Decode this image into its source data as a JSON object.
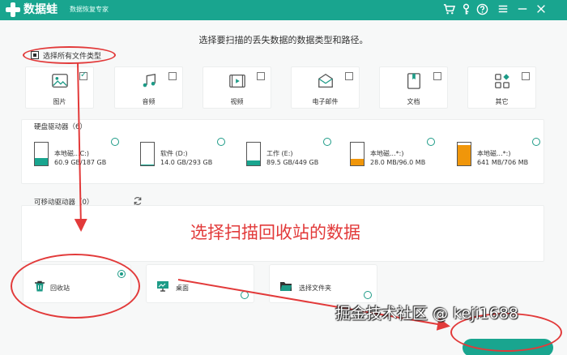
{
  "app": {
    "name": "数据蛙",
    "subtitle": "数据恢复专家"
  },
  "toolbar_icons": [
    "cart-icon",
    "key-icon",
    "help-icon",
    "menu-icon",
    "minimize-icon",
    "close-icon"
  ],
  "instruction": "选择要扫描的丢失数据的数据类型和路径。",
  "select_all_label": "选择所有文件类型",
  "file_types": [
    {
      "label": "图片",
      "icon": "image-icon",
      "checked": true
    },
    {
      "label": "音频",
      "icon": "music-icon",
      "checked": false
    },
    {
      "label": "视频",
      "icon": "video-icon",
      "checked": false
    },
    {
      "label": "电子邮件",
      "icon": "email-icon",
      "checked": false
    },
    {
      "label": "文档",
      "icon": "document-icon",
      "checked": false
    },
    {
      "label": "其它",
      "icon": "grid-icon",
      "checked": false
    }
  ],
  "hard_drives": {
    "title": "硬盘驱动器（6）",
    "items": [
      {
        "name": "本地磁...C:)",
        "size": "60.9 GB/187 GB",
        "fill": 0.33,
        "color": "#19a58f"
      },
      {
        "name": "软件 (D:)",
        "size": "14.0 GB/293 GB",
        "fill": 0.05,
        "color": "#19a58f"
      },
      {
        "name": "工作 (E:)",
        "size": "89.5 GB/449 GB",
        "fill": 0.2,
        "color": "#19a58f"
      },
      {
        "name": "本地磁...*:)",
        "size": "28.0 MB/96.0 MB",
        "fill": 0.29,
        "color": "#f0960a"
      },
      {
        "name": "本地磁...*:)",
        "size": "641 MB/706 MB",
        "fill": 0.91,
        "color": "#f0960a"
      }
    ]
  },
  "removable": {
    "title": "可移动驱动器（0）"
  },
  "overlay_text": "选择扫描回收站的数据",
  "locations": [
    {
      "label": "回收站",
      "icon": "recycle-bin-icon",
      "selected": true
    },
    {
      "label": "桌面",
      "icon": "desktop-icon",
      "selected": false
    },
    {
      "label": "选择文件夹",
      "icon": "folder-icon",
      "selected": false
    }
  ],
  "watermark": "掘金技术社区 @ keji1688",
  "colors": {
    "brand": "#19a58f",
    "annotation": "#e23a3a",
    "drive_orange": "#f0960a"
  }
}
